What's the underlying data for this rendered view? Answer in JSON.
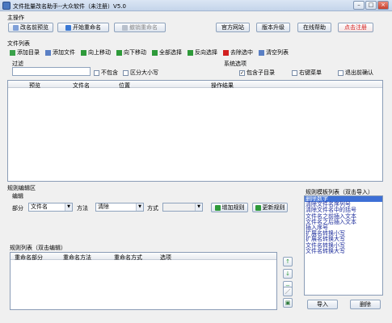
{
  "window": {
    "title": "文件批量改名助手--大众软件（未注册）V5.0",
    "min_icon": "minimize-icon",
    "max_icon": "maximize-icon",
    "close_icon": "close-icon"
  },
  "main_ops": {
    "label": "主操作",
    "preview_button": "改名前预览",
    "start_button": "开始重命名",
    "undo_button": "撤销重命名",
    "official_site_button": "官方网站",
    "upgrade_button": "版本升级",
    "help_button": "在线帮助",
    "register_button": "点击注册"
  },
  "file_list": {
    "label": "文件列表",
    "toolbar": [
      {
        "label": "添加目录",
        "icon": "folder-add-icon",
        "color": "#3aa24a"
      },
      {
        "label": "添加文件",
        "icon": "file-add-icon",
        "color": "#5a7fc4"
      },
      {
        "label": "向上移动",
        "icon": "arrow-up-icon",
        "color": "#2e9a3a"
      },
      {
        "label": "向下移动",
        "icon": "arrow-down-icon",
        "color": "#2e9a3a"
      },
      {
        "label": "全部选择",
        "icon": "check-all-icon",
        "color": "#2e9a3a"
      },
      {
        "label": "反向选择",
        "icon": "invert-select-icon",
        "color": "#2e9a3a"
      },
      {
        "label": "去除选中",
        "icon": "remove-x-icon",
        "color": "#d22020"
      },
      {
        "label": "清空列表",
        "icon": "clear-list-icon",
        "color": "#5a7fc4"
      }
    ],
    "filter_label": "过滤",
    "filter_value": "",
    "exclude_label": "不包含",
    "case_label": "区分大小写",
    "system_options_label": "系统选项",
    "include_subdir_label": "包含子目录",
    "include_subdir_checked": true,
    "context_menu_label": "右键菜单",
    "confirm_exit_label": "退出前确认",
    "columns": [
      "预览",
      "文件名",
      "位置",
      "操作结果"
    ]
  },
  "rule_editor": {
    "label": "规则编辑区",
    "edit_label": "编辑",
    "part_label": "部分",
    "part_value": "文件名",
    "method_label": "方法",
    "method_value": "清除",
    "mode_label": "方式",
    "mode_value": "",
    "add_rule_button": "增加规则",
    "update_rule_button": "更新规则"
  },
  "rules_list": {
    "label": "规则列表（双击编辑）",
    "columns": [
      "重命名部分",
      "重命名方法",
      "重命名方式",
      "选项"
    ]
  },
  "template_list": {
    "label": "规则模板列表（双击导入）",
    "items": [
      "删除数字",
      "清除文件名序列号",
      "清除文件名中的括号",
      "文件名之前插入文本",
      "文件名之后插入文本",
      "插入序号",
      "扩展名转换小写",
      "扩展名转换大写",
      "文件名转换小写",
      "文件名转换大写"
    ],
    "import_button": "导入",
    "delete_button": "删除"
  },
  "side_buttons": [
    "↑",
    "↓",
    "−",
    "／",
    "▣"
  ]
}
